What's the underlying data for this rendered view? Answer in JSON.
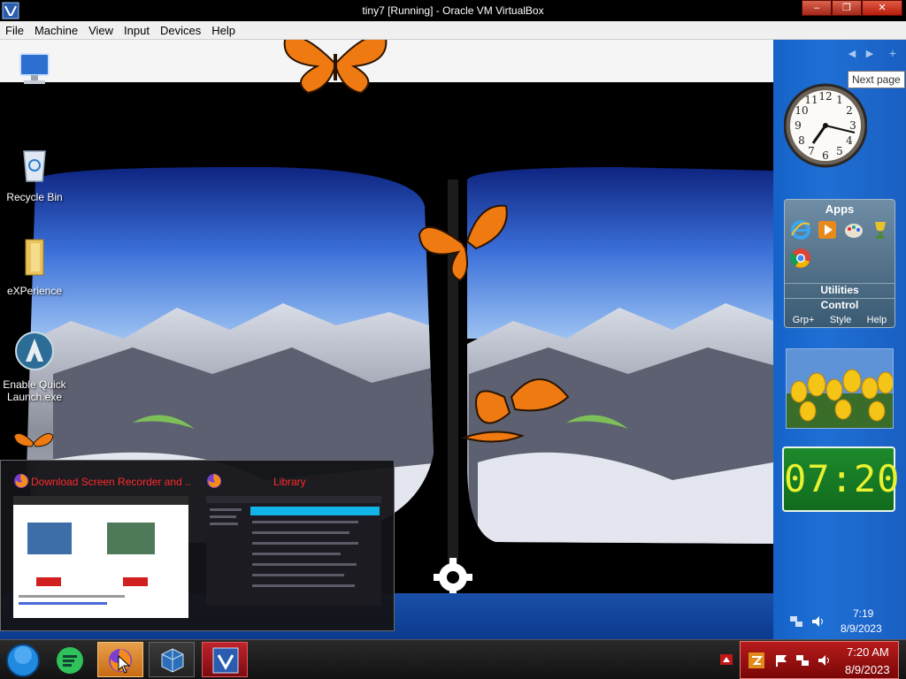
{
  "window": {
    "title": "tiny7 [Running] - Oracle VM VirtualBox",
    "buttons": {
      "minimize": "‒",
      "maximize": "❐",
      "close": "✕"
    }
  },
  "menubar": [
    "File",
    "Machine",
    "View",
    "Input",
    "Devices",
    "Help"
  ],
  "desktop_icons": [
    {
      "label": "Computer",
      "icon": "computer-icon"
    },
    {
      "label": "Recycle Bin",
      "icon": "recycle-bin-icon"
    },
    {
      "label": "eXPerience",
      "icon": "folder-icon"
    },
    {
      "label": "Enable Quick Launch.exe",
      "icon": "quick-launch-icon"
    }
  ],
  "sidebar": {
    "tooltip": "Next page",
    "clock": {
      "numbers": [
        "12",
        "1",
        "2",
        "3",
        "4",
        "5",
        "6",
        "7",
        "8",
        "9",
        "10",
        "11"
      ]
    },
    "apps_gadget": {
      "title": "Apps",
      "icons": [
        "internet-explorer-icon",
        "media-player-icon",
        "paint-icon",
        "trophy-icon",
        "chrome-icon"
      ],
      "rows": [
        "Utilities",
        "Control"
      ],
      "footer": [
        "Grp+",
        "Style",
        "Help"
      ]
    },
    "digital_clock": "07:20"
  },
  "guest_tray": {
    "time": "7:19",
    "date": "8/9/2023"
  },
  "thumbnails": [
    {
      "title": "Download Screen Recorder and ...",
      "icon": "firefox-icon"
    },
    {
      "title": "Library",
      "icon": "firefox-icon"
    }
  ],
  "taskbar": {
    "items": [
      "start-orb-icon",
      "notes-app-icon",
      "firefox-icon",
      "virtualbox-icon",
      "tiny7-vm-icon"
    ]
  },
  "host_tray": {
    "time": "7:20 AM",
    "date": "8/9/2023"
  },
  "colors": {
    "thumbnail_title": "#ff2a2a",
    "digital_clock_digits": "#e8f230",
    "host_tray_bg": "#b81c1c"
  }
}
